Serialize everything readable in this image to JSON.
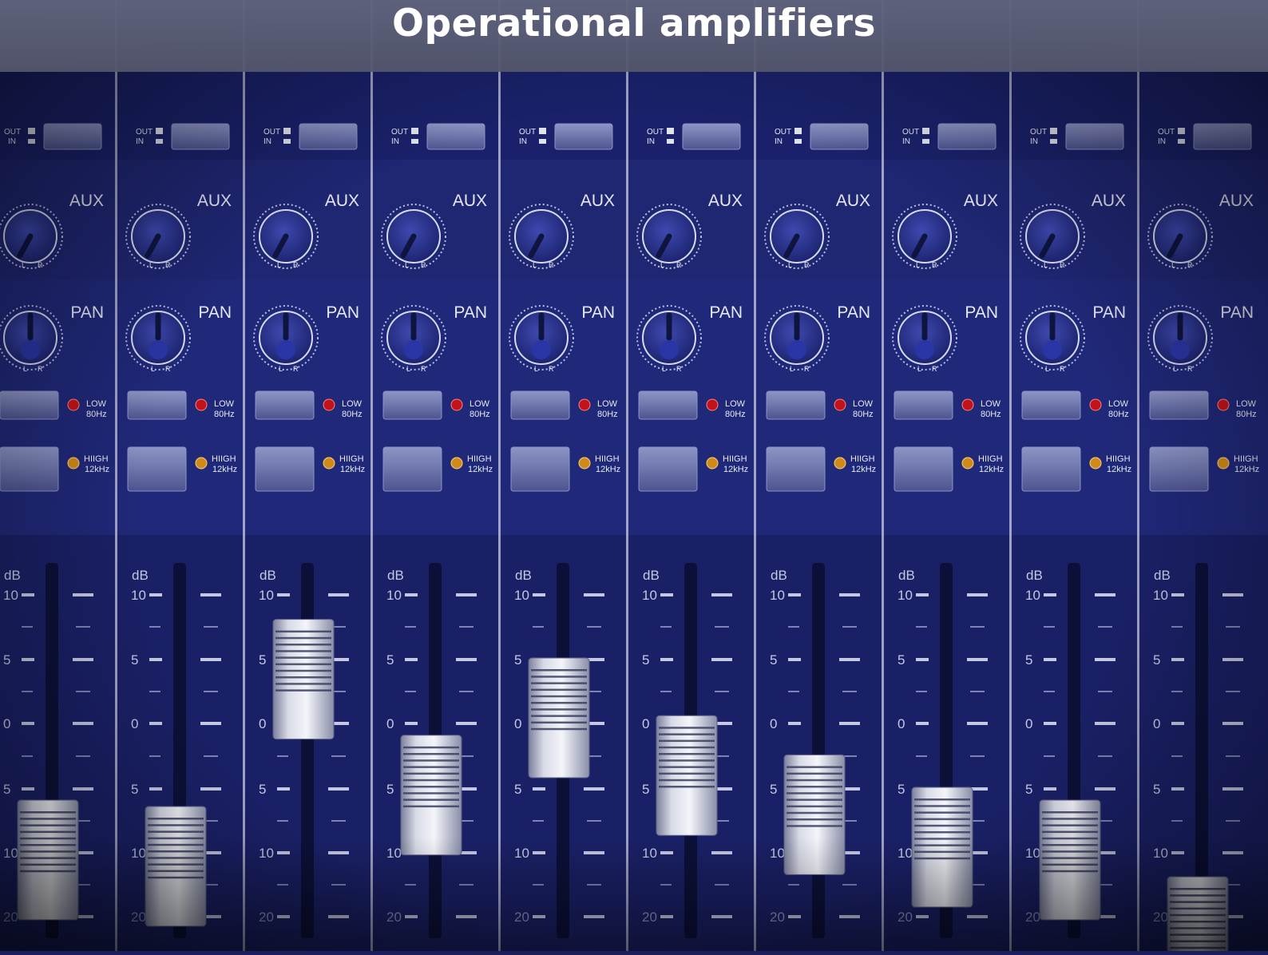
{
  "title": "Operational amplifiers",
  "colors": {
    "panel": "#1f2672",
    "panel_dark": "#161c58",
    "divider": "#c9cde4",
    "label": "#e6e8f5",
    "led_low": "#c0141a",
    "led_high": "#d08a18"
  },
  "labels": {
    "aux": "AUX",
    "pan": "PAN",
    "out": "OUT",
    "in": "IN",
    "low_name": "LOW",
    "low_freq": "80Hz",
    "high_name": "HIIGH",
    "high_freq": "12kHz",
    "pot_l": "L",
    "pot_r": "R",
    "db": "dB"
  },
  "scale_labels": [
    "10",
    "5",
    "0",
    "5",
    "10",
    "20"
  ],
  "channels": [
    {
      "fader_db": -7
    },
    {
      "fader_db": -7.5
    },
    {
      "fader_db": 7
    },
    {
      "fader_db": -2
    },
    {
      "fader_db": 4
    },
    {
      "fader_db": -0.5
    },
    {
      "fader_db": -3.5
    },
    {
      "fader_db": -6
    },
    {
      "fader_db": -7
    },
    {
      "fader_db": -16
    }
  ]
}
